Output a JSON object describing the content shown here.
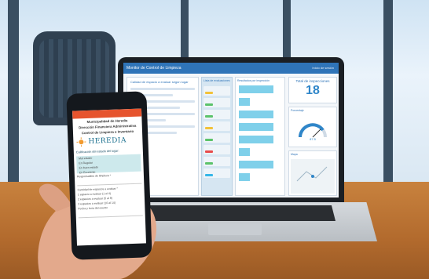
{
  "laptop_app": {
    "header_title": "Monitor de Control de Limpieza",
    "header_right": "Inicio de sesión",
    "form_panel_title": "Calidad de espacio a evaluar según lugar",
    "list_panel_title": "Lista de evaluaciones",
    "bars_panel_title": "Resultados por inspección",
    "kpi_label": "Total de inspecciones",
    "kpi_value": "18",
    "gauge_label": "Porcentaje",
    "gauge_value": "87.5",
    "map_label": "Mapa"
  },
  "phone_app": {
    "title_line1": "Municipalidad de Heredia",
    "title_line2": "Dirección Financiera Administrativa",
    "title_line3": "Control de Limpieza e Inventario",
    "brand": "HEREDIA",
    "section1": "Calificación del estado del lugar:",
    "block_items": [
      "Mal estado",
      "En Regular",
      "En buen estado",
      "En Excelente"
    ],
    "field1": "Responsables de limpieza *",
    "field2": "Cantidad de espacios a evaluar *",
    "opt1": "1 espacio a evaluar (1 al 4)",
    "opt2": "2 espacios a evaluar (5 al 9)",
    "opt3": "3 espacios a evaluar (10 al 14)",
    "field3": "Fecha y hora del evento"
  },
  "colors": {
    "accent": "#2f74b8",
    "phone_accent": "#e6542e",
    "kpi": "#2f86c9"
  }
}
